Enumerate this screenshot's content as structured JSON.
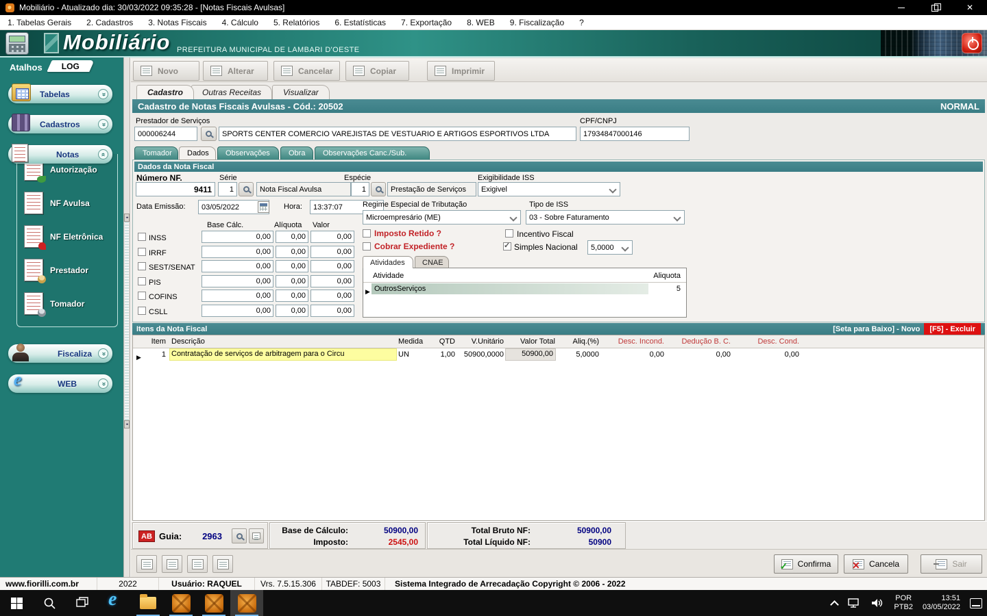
{
  "window": {
    "title": "Mobiliário - Atualizado dia: 30/03/2022 09:35:28 - [Notas Fiscais Avulsas]"
  },
  "menubar": [
    "1. Tabelas Gerais",
    "2. Cadastros",
    "3. Notas Fiscais",
    "4. Cálculo",
    "5. Relatórios",
    "6. Estatísticas",
    "7. Exportação",
    "8. WEB",
    "9. Fiscalização",
    "?"
  ],
  "brand": {
    "name": "Mobiliário",
    "subtitle": "PREFEITURA MUNICIPAL DE LAMBARI D'OESTE"
  },
  "sidebar": {
    "tab_atalhos": "Atalhos",
    "tab_log": "LOG",
    "groups": {
      "tabelas": "Tabelas",
      "cadastros": "Cadastros",
      "notas": "Notas",
      "fiscaliza": "Fiscaliza",
      "web": "WEB"
    },
    "notas_items": [
      {
        "label": "Autorização"
      },
      {
        "label": "NF Avulsa"
      },
      {
        "label": "NF Eletrônica"
      },
      {
        "label": "Prestador"
      },
      {
        "label": "Tomador"
      }
    ]
  },
  "toolbar": {
    "novo": "Novo",
    "alterar": "Alterar",
    "cancelar": "Cancelar",
    "copiar": "Copiar",
    "imprimir": "Imprimir"
  },
  "page_tabs": {
    "cadastro": "Cadastro",
    "outras_receitas": "Outras Receitas",
    "visualizar": "Visualizar"
  },
  "form_header": {
    "title": "Cadastro de Notas Fiscais Avulsas - Cód.: 20502",
    "mode": "NORMAL"
  },
  "prestador": {
    "label": "Prestador de Serviços",
    "code": "000006244",
    "name": "SPORTS CENTER COMERCIO VAREJISTAS DE VESTUARIO E ARTIGOS ESPORTIVOS LTDA",
    "cnpj_label": "CPF/CNPJ",
    "cnpj": "17934847000146"
  },
  "detail_tabs": {
    "tomador": "Tomador",
    "dados": "Dados",
    "observacoes": "Observações",
    "obra": "Obra",
    "obs_canc": "Observações Canc./Sub."
  },
  "nota": {
    "section_title": "Dados da Nota Fiscal",
    "numero_label": "Número NF.",
    "numero": "9411",
    "serie_label": "Série",
    "serie": "1",
    "serie_desc": "Nota Fiscal Avulsa",
    "especie_label": "Espécie",
    "especie": "1",
    "especie_desc": "Prestação de Serviços",
    "exigibilidade_label": "Exigibilidade ISS",
    "exigibilidade": "Exigivel",
    "data_label": "Data Emissão:",
    "data": "03/05/2022",
    "hora_label": "Hora:",
    "hora": "13:37:07",
    "regime_label": "Regime Especial de Tributação",
    "regime": "Microempresário (ME)",
    "tipo_iss_label": "Tipo de ISS",
    "tipo_iss": "03 - Sobre Faturamento",
    "col_base": "Base Cálc.",
    "col_aliquota": "Alíquota",
    "col_valor": "Valor",
    "taxes": [
      {
        "name": "INSS",
        "base": "0,00",
        "aliq": "0,00",
        "valor": "0,00"
      },
      {
        "name": "IRRF",
        "base": "0,00",
        "aliq": "0,00",
        "valor": "0,00"
      },
      {
        "name": "SEST/SENAT",
        "base": "0,00",
        "aliq": "0,00",
        "valor": "0,00"
      },
      {
        "name": "PIS",
        "base": "0,00",
        "aliq": "0,00",
        "valor": "0,00"
      },
      {
        "name": "COFINS",
        "base": "0,00",
        "aliq": "0,00",
        "valor": "0,00"
      },
      {
        "name": "CSLL",
        "base": "0,00",
        "aliq": "0,00",
        "valor": "0,00"
      }
    ],
    "chk_imposto_retido": "Imposto Retido ?",
    "chk_cobrar_expediente": "Cobrar Expediente ?",
    "chk_incentivo_fiscal": "Incentivo Fiscal",
    "chk_simples_nacional": "Simples Nacional",
    "simples_aliquota": "5,0000",
    "tab_atividades": "Atividades",
    "tab_cnae": "CNAE",
    "atividade_col": "Atividade",
    "aliquota_col": "Aliquota",
    "atividade": "OutrosServiços",
    "atividade_aliquota": "5"
  },
  "itens": {
    "section_title": "Itens da Nota Fiscal",
    "hint_novo": "[Seta para Baixo] - Novo",
    "hint_excluir": "[F5] - Excluir",
    "headers": [
      "Item",
      "Descrição",
      "Medida",
      "QTD",
      "V.Unitário",
      "Valor Total",
      "Aliq.(%)",
      "Desc. Incond.",
      "Dedução B. C.",
      "Desc. Cond."
    ],
    "rows": [
      {
        "item": "1",
        "descricao": "Contratação de serviços de arbitragem para o Circu",
        "medida": "UN",
        "qtd": "1,00",
        "v_unitario": "50900,0000",
        "valor_total": "50900,00",
        "aliq": "5,0000",
        "desc_incond": "0,00",
        "deducao_bc": "0,00",
        "desc_cond": "0,00"
      }
    ]
  },
  "resumo": {
    "ab": "AB",
    "guia_label": "Guia:",
    "guia": "2963",
    "base_label": "Base de Cálculo:",
    "base": "50900,00",
    "imposto_label": "Imposto:",
    "imposto": "2545,00",
    "bruto_label": "Total Bruto NF:",
    "bruto": "50900,00",
    "liquido_label": "Total Líquido NF:",
    "liquido": "50900"
  },
  "actions": {
    "confirma": "Confirma",
    "cancela": "Cancela",
    "sair": "Sair"
  },
  "statusbar": {
    "site": "www.fiorilli.com.br",
    "year": "2022",
    "user": "Usuário: RAQUEL",
    "version": "Vrs. 7.5.15.306",
    "tabdef": "TABDEF: 5003",
    "copyright": "Sistema Integrado de Arrecadação Copyright © 2006 - 2022"
  },
  "taskbar": {
    "lang_top": "POR",
    "lang_bottom": "PTB2",
    "time": "13:51",
    "date": "03/05/2022"
  },
  "colors": {
    "teal_bar": "#3c7f87",
    "sidebar_teal": "#207b74",
    "alert_red": "#cc2222",
    "value_navy": "#000080",
    "highlight_yellow": "#fdfda0"
  }
}
